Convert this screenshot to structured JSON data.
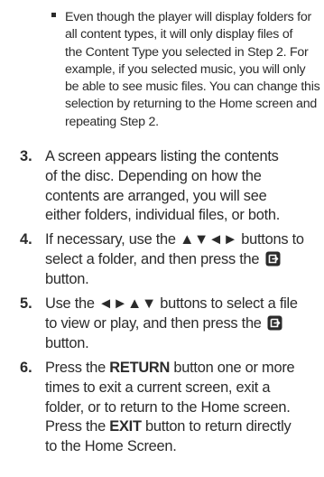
{
  "bullet": {
    "lines": [
      "Even though the player will display folders for",
      "all content types, it will only display files of",
      "the Content Type you selected in Step 2. For",
      "example, if you selected music, you will only",
      "be able to see music files. You can change this",
      "selection by returning to the Home screen and",
      "repeating Step 2."
    ]
  },
  "steps": {
    "s3": {
      "number": "3.",
      "lines": [
        "A screen appears listing the contents",
        "of the disc. Depending on how the",
        "contents are arranged, you will see",
        "either folders, individual files, or both."
      ]
    },
    "s4": {
      "number": "4.",
      "line1": "If necessary, use the ▲▼◄► buttons to",
      "line2": "select a folder, and then press the",
      "line3": "button.",
      "icon": "enter-button-icon"
    },
    "s5": {
      "number": "5.",
      "line1": "Use the ◄►▲▼ buttons to select a file",
      "line2": "to view or play, and then press the",
      "line3": "button.",
      "icon": "enter-button-icon"
    },
    "s6": {
      "number": "6.",
      "line1_pre": "Press the ",
      "line1_bold": "RETURN",
      "line1_post": " button one or more",
      "line2": "times to exit a current screen, exit a",
      "line3": "folder, or to return to the Home screen.",
      "line4_pre": "Press the ",
      "line4_bold": "EXIT",
      "line4_post": " button to return directly",
      "line5": "to the Home Screen."
    }
  }
}
